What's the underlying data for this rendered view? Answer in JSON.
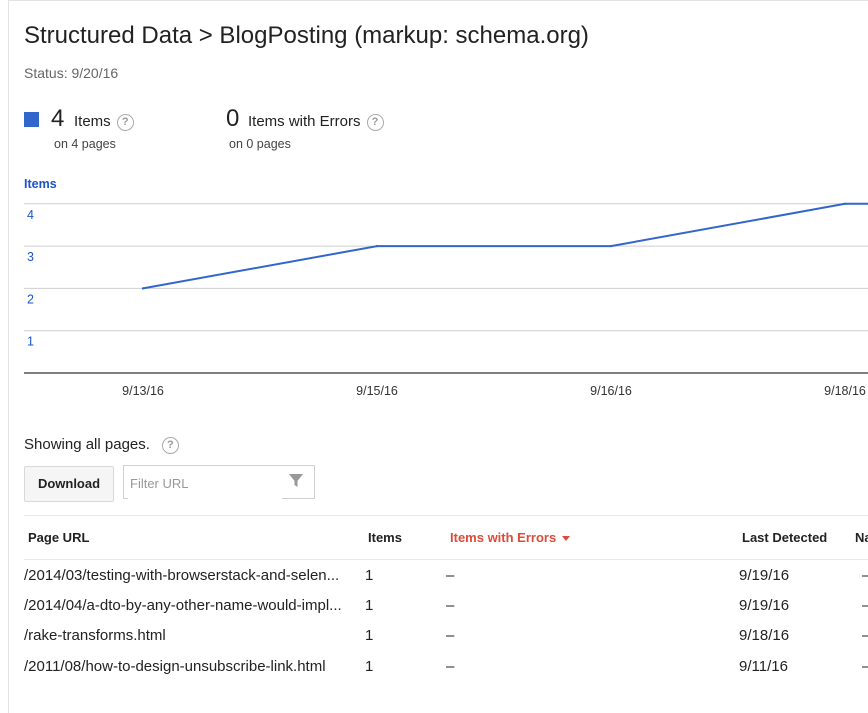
{
  "header": {
    "title": "Structured Data > BlogPosting (markup: schema.org)",
    "status": "Status: 9/20/16"
  },
  "stats": {
    "items": {
      "count": "4",
      "label": "Items",
      "sub": "on 4 pages",
      "color": "#3366cc"
    },
    "errors": {
      "count": "0",
      "label": "Items with Errors",
      "sub": "on 0 pages"
    }
  },
  "chart_data": {
    "type": "line",
    "ylabel": "Items",
    "x": [
      "9/13/16",
      "9/15/16",
      "9/16/16",
      "9/18/16"
    ],
    "y_ticks": [
      1,
      2,
      3,
      4
    ],
    "ylim": [
      0,
      4
    ],
    "series": [
      {
        "values": [
          2,
          3,
          3,
          4
        ],
        "color": "#3366cc"
      }
    ],
    "grid": true
  },
  "pages": {
    "showing": "Showing all pages.",
    "download_label": "Download",
    "filter_placeholder": "Filter URL"
  },
  "table": {
    "headers": {
      "url": "Page URL",
      "items": "Items",
      "errors": "Items with Errors",
      "last_detected": "Last Detected",
      "extra": "Na"
    },
    "rows": [
      {
        "url": "/2014/03/testing-with-browserstack-and-selen...",
        "items": "1",
        "errors": "–",
        "last": "9/19/16",
        "extra": "–"
      },
      {
        "url": "/2014/04/a-dto-by-any-other-name-would-impl...",
        "items": "1",
        "errors": "–",
        "last": "9/19/16",
        "extra": "–"
      },
      {
        "url": "/rake-transforms.html",
        "items": "1",
        "errors": "–",
        "last": "9/18/16",
        "extra": "–"
      },
      {
        "url": "/2011/08/how-to-design-unsubscribe-link.html",
        "items": "1",
        "errors": "–",
        "last": "9/11/16",
        "extra": "–"
      }
    ]
  }
}
